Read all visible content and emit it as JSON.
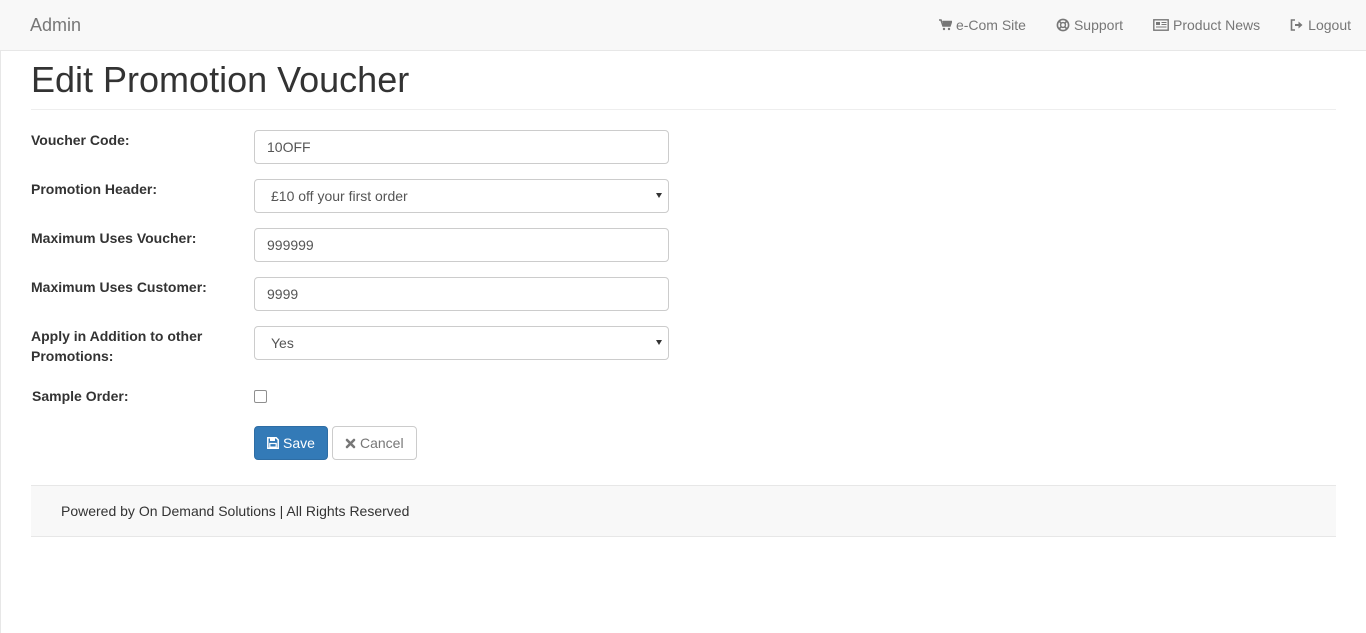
{
  "navbar": {
    "brand": "Admin",
    "links": [
      {
        "label": "e-Com Site",
        "icon": "shopping-cart-icon"
      },
      {
        "label": "Support",
        "icon": "life-ring-icon"
      },
      {
        "label": "Product News",
        "icon": "newspaper-icon"
      },
      {
        "label": "Logout",
        "icon": "sign-out-icon"
      }
    ]
  },
  "page": {
    "title": "Edit Promotion Voucher"
  },
  "form": {
    "voucher_code": {
      "label": "Voucher Code:",
      "value": "10OFF"
    },
    "promotion_header": {
      "label": "Promotion Header:",
      "value": "£10 off your first order"
    },
    "max_uses_voucher": {
      "label": "Maximum Uses Voucher:",
      "value": "999999"
    },
    "max_uses_customer": {
      "label": "Maximum Uses Customer:",
      "value": "9999"
    },
    "apply_in_addition": {
      "label_line1": "Apply in Addition to other",
      "label_line2": "Promotions:",
      "value": "Yes"
    },
    "sample_order": {
      "label": "Sample Order:",
      "checked": false
    },
    "save_label": "Save",
    "cancel_label": "Cancel"
  },
  "footer": {
    "text": "Powered by On Demand Solutions | All Rights Reserved"
  },
  "colors": {
    "primary": "#337ab7",
    "navbar_bg": "#f8f8f8"
  }
}
